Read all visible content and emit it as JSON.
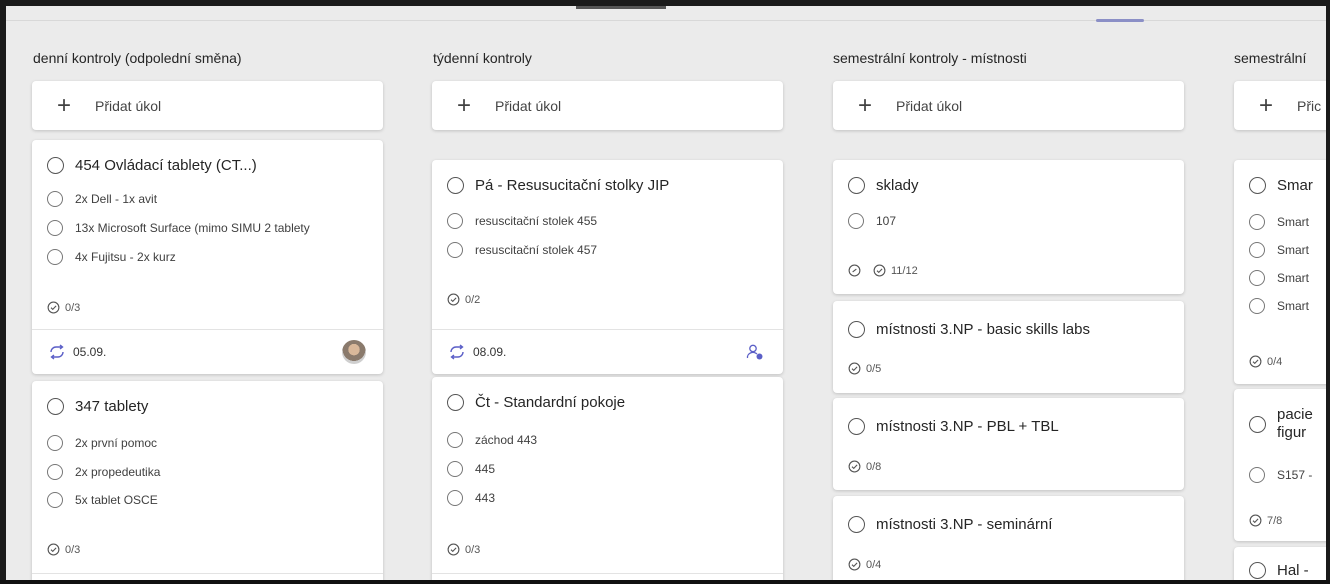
{
  "add_task_label": "Přidat úkol",
  "colors": {
    "board_bg": "#ebebeb",
    "accent": "#8b8fc6",
    "card_bg": "#ffffff"
  },
  "icons": {
    "add": "plus-icon",
    "complete": "circle-icon",
    "progress": "check-circle-icon",
    "repeat": "repeat-icon",
    "comment": "comment-icon",
    "assign": "assign-person-icon"
  },
  "buckets": [
    {
      "title": "denní kontroly (odpolední směna)",
      "cards": [
        {
          "title": "454 Ovládací tablety (CT...)",
          "items": [
            "2x Dell - 1x avit",
            "13x Microsoft Surface (mimo SIMU 2 tablety",
            "4x Fujitsu - 2x kurz"
          ],
          "progress": "0/3",
          "due": "05.09."
        },
        {
          "title": "347 tablety",
          "items": [
            "2x první pomoc",
            "2x propedeutika",
            "5x tablet OSCE"
          ],
          "progress": "0/3"
        }
      ]
    },
    {
      "title": "týdenní kontroly",
      "cards": [
        {
          "title": "Pá - Resusucitační stolky JIP",
          "items": [
            "resuscitační stolek 455",
            "resuscitační stolek 457"
          ],
          "progress": "0/2",
          "due": "08.09."
        },
        {
          "title": "Čt - Standardní pokoje",
          "items": [
            "záchod 443",
            "445",
            "443"
          ],
          "progress": "0/3"
        }
      ]
    },
    {
      "title": "semestrální kontroly - místnosti",
      "cards": [
        {
          "title": "sklady",
          "items": [
            "107"
          ],
          "progress": "11/12"
        },
        {
          "title": "místnosti 3.NP - basic skills labs",
          "progress": "0/5"
        },
        {
          "title": "místnosti 3.NP - PBL + TBL",
          "progress": "0/8"
        },
        {
          "title": "místnosti 3.NP - seminární",
          "progress": "0/4"
        }
      ]
    },
    {
      "title": "semestrální",
      "add_label": "Přic",
      "cards": [
        {
          "title": "Smar",
          "items": [
            "Smart",
            "Smart",
            "Smart",
            "Smart"
          ],
          "progress": "0/4"
        },
        {
          "title_line1": "pacie",
          "title_line2": "figur",
          "items": [
            "S157 -"
          ],
          "progress": "7/8"
        },
        {
          "title": "Hal -"
        }
      ]
    }
  ]
}
